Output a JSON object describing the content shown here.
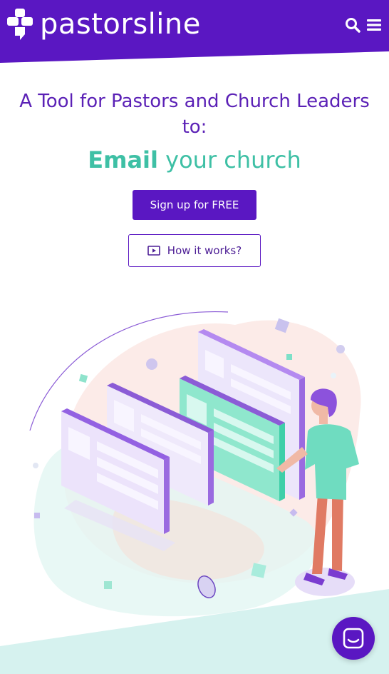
{
  "header": {
    "brand": "pastorsline",
    "bg_color": "#5a17c2",
    "icons": [
      "search-icon",
      "menu-icon"
    ]
  },
  "hero": {
    "headline": "A Tool for Pastors and Church Leaders to:",
    "subline_bold": "Email",
    "subline_rest": " your church",
    "primary_cta": "Sign up for FREE",
    "secondary_cta": "How it works?"
  },
  "colors": {
    "purple": "#5a17c2",
    "teal": "#3ec0a5",
    "headline": "#5b21b6"
  },
  "chat": {
    "icon": "chat-icon"
  }
}
